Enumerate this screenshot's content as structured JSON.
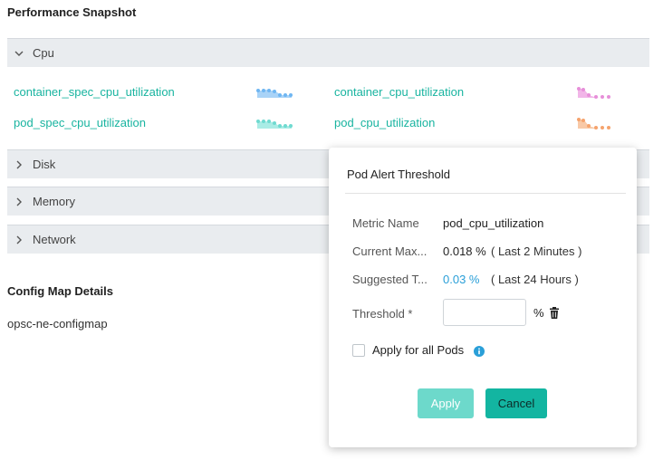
{
  "page": {
    "title": "Performance Snapshot"
  },
  "accordion": {
    "cpu": {
      "label": "Cpu",
      "expanded": true
    },
    "disk": {
      "label": "Disk"
    },
    "memory": {
      "label": "Memory"
    },
    "network": {
      "label": "Network"
    }
  },
  "cpu_metrics": [
    {
      "label": "container_spec_cpu_utilization",
      "spark_color": "#6fb6f2",
      "spark_icon": "sparkline-icon"
    },
    {
      "label": "container_cpu_utilization",
      "spark_color": "#e78fd9",
      "spark_icon": "sparkline-icon"
    },
    {
      "label": "pod_spec_cpu_utilization",
      "spark_color": "#6fdad0",
      "spark_icon": "sparkline-icon"
    },
    {
      "label": "pod_cpu_utilization",
      "spark_color": "#f5a36d",
      "spark_icon": "sparkline-icon"
    }
  ],
  "config_map": {
    "title": "Config Map Details",
    "item": "opsc-ne-configmap"
  },
  "popup": {
    "title": "Pod Alert Threshold",
    "metric_name_label": "Metric Name",
    "metric_name_value": "pod_cpu_utilization",
    "current_max_label": "Current Max...",
    "current_max_value": "0.018 %",
    "current_max_note": "( Last 2 Minutes )",
    "suggested_label": "Suggested T...",
    "suggested_value": "0.03 %",
    "suggested_note": "( Last 24 Hours )",
    "threshold_label": "Threshold *",
    "threshold_value": "",
    "threshold_unit": "%",
    "apply_all_label": "Apply for all Pods",
    "apply_label": "Apply",
    "cancel_label": "Cancel"
  },
  "colors": {
    "link": "#19b4a0",
    "accent": "#13b5a1",
    "suggested": "#2a9fd8"
  }
}
